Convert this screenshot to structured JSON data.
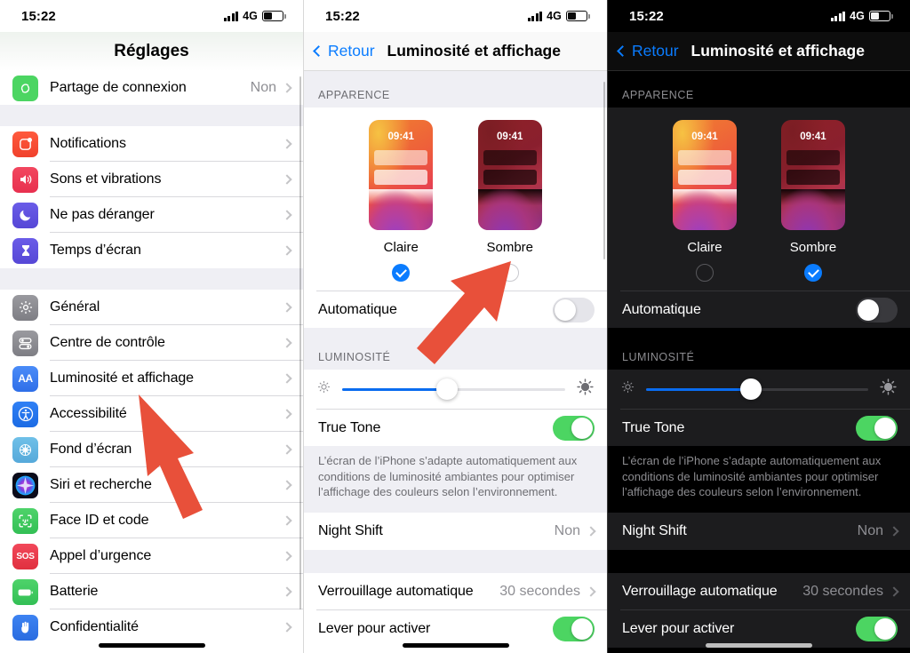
{
  "status_bar": {
    "time": "15:22",
    "network": "4G",
    "signal_icon": "signal-bars-icon",
    "battery_icon": "battery-icon"
  },
  "accent": {
    "blue": "#0a7cff",
    "green": "#4cd562",
    "arrow_red": "#e8503a",
    "slider_blue": "#0a6cf0"
  },
  "panel_settings": {
    "title": "Réglages",
    "pinned_row": {
      "label": "Partage de connexion",
      "value": "Non",
      "icon": "hotspot-icon"
    },
    "group_notifications": [
      {
        "label": "Notifications",
        "icon": "notifications-icon"
      },
      {
        "label": "Sons et vibrations",
        "icon": "sounds-icon"
      },
      {
        "label": "Ne pas déranger",
        "icon": "do-not-disturb-icon"
      },
      {
        "label": "Temps d’écran",
        "icon": "screen-time-icon"
      }
    ],
    "group_general": [
      {
        "label": "Général",
        "icon": "general-gear-icon"
      },
      {
        "label": "Centre de contrôle",
        "icon": "control-center-icon"
      },
      {
        "label": "Luminosité et affichage",
        "icon": "display-brightness-icon"
      },
      {
        "label": "Accessibilité",
        "icon": "accessibility-icon"
      },
      {
        "label": "Fond d’écran",
        "icon": "wallpaper-icon"
      },
      {
        "label": "Siri et recherche",
        "icon": "siri-icon"
      },
      {
        "label": "Face ID et code",
        "icon": "face-id-icon"
      },
      {
        "label": "Appel d’urgence",
        "icon": "sos-icon"
      },
      {
        "label": "Batterie",
        "icon": "battery-settings-icon"
      },
      {
        "label": "Confidentialité",
        "icon": "privacy-hand-icon"
      }
    ]
  },
  "panel_display_light": {
    "back_label": "Retour",
    "title": "Luminosité et affichage",
    "appearance_header": "APPARENCE",
    "appearance_options": [
      {
        "label": "Claire",
        "preview_time": "09:41",
        "selected": true
      },
      {
        "label": "Sombre",
        "preview_time": "09:41",
        "selected": false
      }
    ],
    "automatic_row": {
      "label": "Automatique",
      "enabled": false
    },
    "brightness_header": "LUMINOSITÉ",
    "brightness_value": 47,
    "true_tone_row": {
      "label": "True Tone",
      "enabled": true
    },
    "true_tone_note": "L’écran de l’iPhone s’adapte automatiquement aux conditions de luminosité ambiantes pour optimiser l’affichage des couleurs selon l’environnement.",
    "night_shift_row": {
      "label": "Night Shift",
      "value": "Non"
    },
    "auto_lock_row": {
      "label": "Verrouillage automatique",
      "value": "30 secondes"
    },
    "raise_to_wake_row": {
      "label": "Lever pour activer",
      "enabled": true
    }
  },
  "panel_display_dark": {
    "back_label": "Retour",
    "title": "Luminosité et affichage",
    "appearance_header": "APPARENCE",
    "appearance_options": [
      {
        "label": "Claire",
        "preview_time": "09:41",
        "selected": false
      },
      {
        "label": "Sombre",
        "preview_time": "09:41",
        "selected": true
      }
    ],
    "automatic_row": {
      "label": "Automatique",
      "enabled": false
    },
    "brightness_header": "LUMINOSITÉ",
    "brightness_value": 47,
    "true_tone_row": {
      "label": "True Tone",
      "enabled": true
    },
    "true_tone_note": "L’écran de l’iPhone s’adapte automatiquement aux conditions de luminosité ambiantes pour optimiser l’affichage des couleurs selon l’environnement.",
    "night_shift_row": {
      "label": "Night Shift",
      "value": "Non"
    },
    "auto_lock_row": {
      "label": "Verrouillage automatique",
      "value": "30 secondes"
    },
    "raise_to_wake_row": {
      "label": "Lever pour activer",
      "enabled": true
    }
  },
  "annotations": [
    {
      "name": "arrow-to-display-settings",
      "points_at": "Luminosité et affichage"
    },
    {
      "name": "arrow-to-dark-radio",
      "points_at": "Sombre radio button"
    }
  ]
}
